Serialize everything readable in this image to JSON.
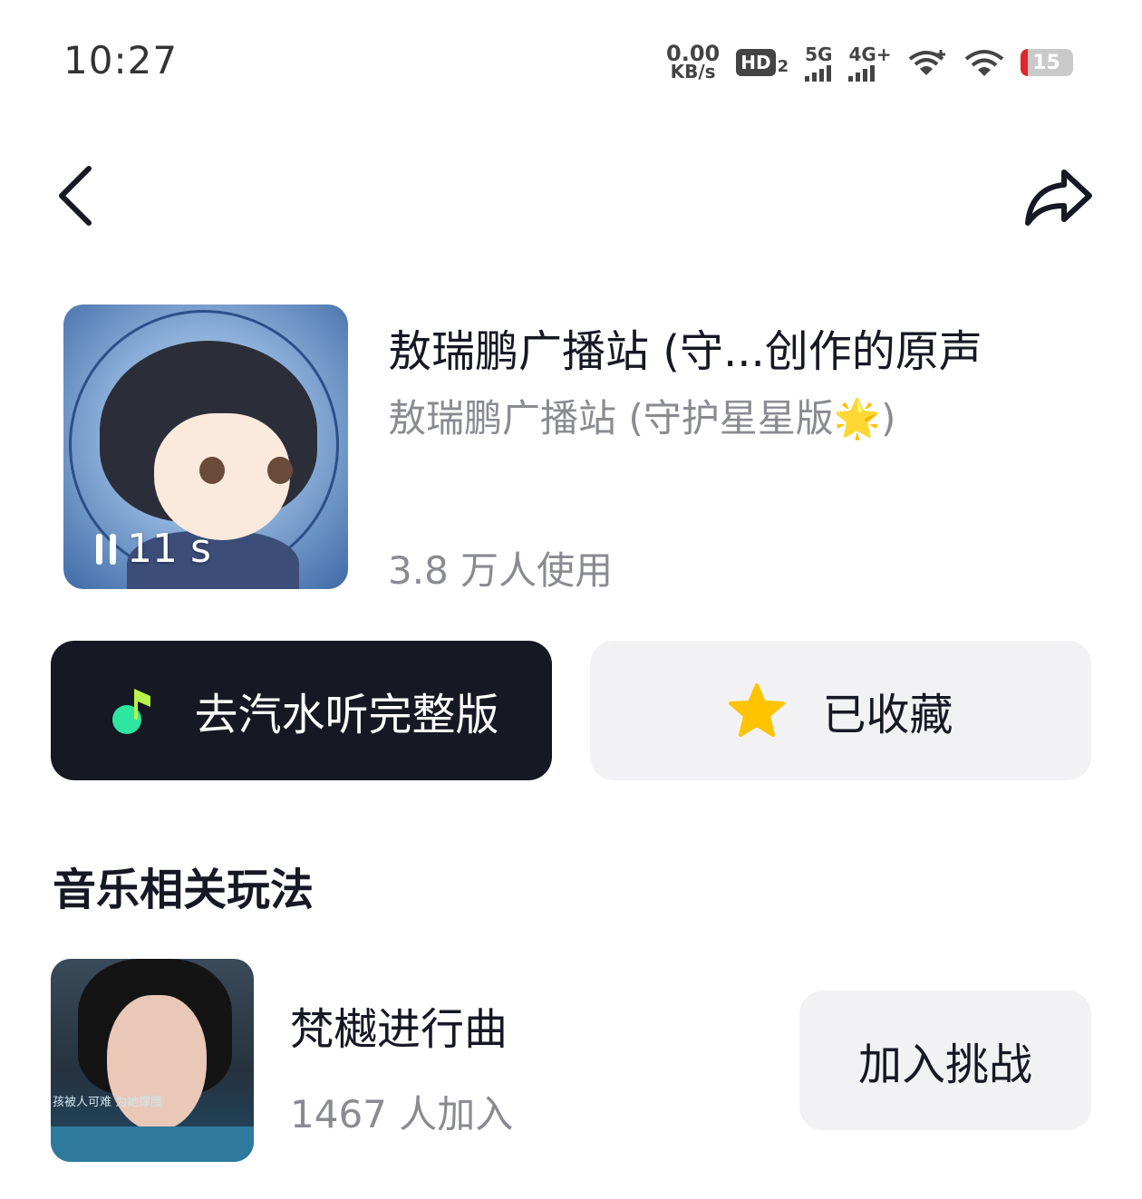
{
  "status_bar": {
    "time": "10:27",
    "net_speed_value": "0.00",
    "net_speed_unit": "KB/s",
    "hd_label": "HD",
    "hd_sub": "2",
    "sig1_label": "5G",
    "sig2_label": "4G+",
    "battery": "15",
    "battery_low_color": "#e0262b"
  },
  "nav": {
    "back_icon": "chevron-left-icon",
    "share_icon": "share-arrow-icon"
  },
  "music": {
    "title": "敖瑞鹏广播站 (守...创作的原声",
    "artist": "敖瑞鹏广播站 (守护星星版🌟)",
    "usage": "3.8 万人使用",
    "duration": "11 s"
  },
  "actions": {
    "listen_full_label": "去汽水听完整版",
    "favorite_label": "已收藏",
    "favorite_star_color": "#ffc300",
    "app_icon_color": "#2ee6a0"
  },
  "related": {
    "section_title": "音乐相关玩法",
    "items": [
      {
        "title": "梵樾进行曲",
        "count": "1467 人加入",
        "button_label": "加入挑战",
        "thumb_caption": "孩被人可难 为她撑腰"
      }
    ]
  }
}
